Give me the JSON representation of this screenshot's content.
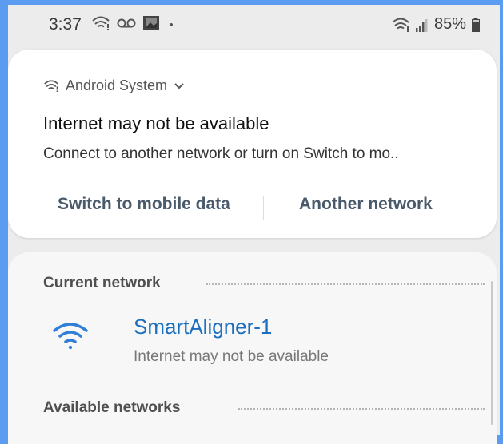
{
  "status_bar": {
    "time": "3:37",
    "battery_text": "85%",
    "icons": [
      "wifi-warning-icon",
      "voicemail-icon",
      "gallery-icon",
      "dot-icon",
      "wifi-warning-icon",
      "signal-icon",
      "battery-icon"
    ]
  },
  "notification": {
    "app_name": "Android System",
    "title": "Internet may not be available",
    "body": "Connect to another network or turn on Switch to mo..",
    "actions": {
      "switch_mobile": "Switch to mobile data",
      "another_network": "Another network"
    }
  },
  "networks": {
    "current_label": "Current network",
    "current": {
      "name": "SmartAligner-1",
      "status": "Internet may not be available"
    },
    "available_label": "Available networks"
  },
  "colors": {
    "accent": "#1b6fbf",
    "wifi_icon": "#2f7fd9",
    "frame": "#5b9bf0"
  }
}
